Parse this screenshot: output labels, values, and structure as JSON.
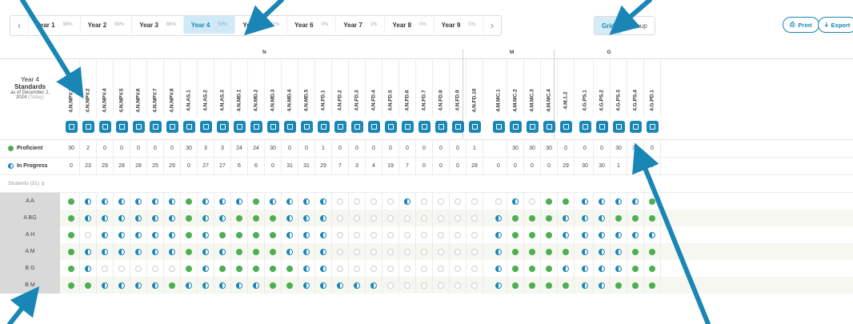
{
  "year_tabs": [
    {
      "label": "Year 1",
      "pct": "98%"
    },
    {
      "label": "Year 2",
      "pct": "98%"
    },
    {
      "label": "Year 3",
      "pct": "86%"
    },
    {
      "label": "Year 4",
      "pct": "58%",
      "active": true
    },
    {
      "label": "Year 5",
      "pct": "22%"
    },
    {
      "label": "Year 6",
      "pct": "0%"
    },
    {
      "label": "Year 7",
      "pct": "1%"
    },
    {
      "label": "Year 8",
      "pct": "0%"
    },
    {
      "label": "Year 9",
      "pct": "0%"
    }
  ],
  "view_toggle": {
    "grid": "Grid",
    "group": "Group"
  },
  "actions": {
    "print": "Print",
    "export": "Export"
  },
  "header": {
    "line1": "Year 4",
    "line2": "Standards",
    "line3": "as of December 2,",
    "line4": "2024",
    "today": "(Today)"
  },
  "domains": [
    {
      "label": "N",
      "start": 0,
      "end": 23
    },
    {
      "label": "M",
      "start": 24,
      "end": 28
    },
    {
      "label": "G",
      "start": 29,
      "end": 34
    }
  ],
  "standards": [
    "4.N.NPV.1",
    "4.N.NPV.2",
    "4.N.NPV.4",
    "4.N.NPV.5",
    "4.N.NPV.6",
    "4.N.NPV.7",
    "4.N.NPV.8",
    "4.N.AS.1",
    "4.N.AS.2",
    "4.N.AS.3",
    "4.N.MD.1",
    "4.N.MD.2",
    "4.N.MD.3",
    "4.N.MD.4",
    "4.N.MD.5",
    "4.N.FD.1",
    "4.N.FD.2",
    "4.N.FD.3",
    "4.N.FD.4",
    "4.N.FD.5",
    "4.N.FD.6",
    "4.N.FD.7",
    "4.N.FD.8",
    "4.N.FD.9",
    "4.N.FD.10",
    "4.M.MC.1",
    "4.M.MC.2",
    "4.M.MC.3",
    "4.M.MC.4",
    "4.M.1.2",
    "4.G.PS.1",
    "4.G.PS.2",
    "4.G.PS.3",
    "4.G.PS.4",
    "4.G.PD.1"
  ],
  "rows": {
    "proficient_label": "Proficient",
    "in_progress_label": "In Progress",
    "students_label": "Students (31)",
    "proficient": [
      "30",
      "2",
      "0",
      "0",
      "0",
      "0",
      "0",
      "30",
      "3",
      "3",
      "24",
      "24",
      "30",
      "0",
      "0",
      "1",
      "0",
      "0",
      "0",
      "0",
      "0",
      "0",
      "0",
      "0",
      "1",
      "",
      "30",
      "30",
      "30",
      "0",
      "0",
      "0",
      "30",
      "30",
      "0"
    ],
    "in_progress": [
      "0",
      "23",
      "29",
      "28",
      "28",
      "25",
      "29",
      "0",
      "27",
      "27",
      "6",
      "6",
      "0",
      "31",
      "31",
      "29",
      "7",
      "3",
      "4",
      "19",
      "7",
      "0",
      "0",
      "0",
      "28",
      "0",
      "0",
      "0",
      "0",
      "29",
      "30",
      "30",
      "1",
      "1",
      "0"
    ]
  },
  "students": [
    {
      "name": "A A",
      "marks": "piiiiiipiiipiiiinnnninnnnninppiiiippn"
    },
    {
      "name": "A BG",
      "marks": "piiiiiipiipppiiinnnnnnnnnipppiiipppnn"
    },
    {
      "name": "A H",
      "marks": "pniiiiipippppiiinnnnnnnnnipppiiiiiinn"
    },
    {
      "name": "A M",
      "marks": "piiiiiipiipppiiinnnnnnnnnippppiiippnn"
    },
    {
      "name": "B G",
      "marks": "pinnnnnpipppppiinnnnnnnnnipppiiiippnn"
    },
    {
      "name": "B M",
      "marks": "ppiiiipiiiiippiiiiinnnnnnippppiipppnn"
    }
  ],
  "colors": {
    "accent": "#1a86b5",
    "proficient": "#4caf50",
    "arrow": "#1a86b5"
  }
}
